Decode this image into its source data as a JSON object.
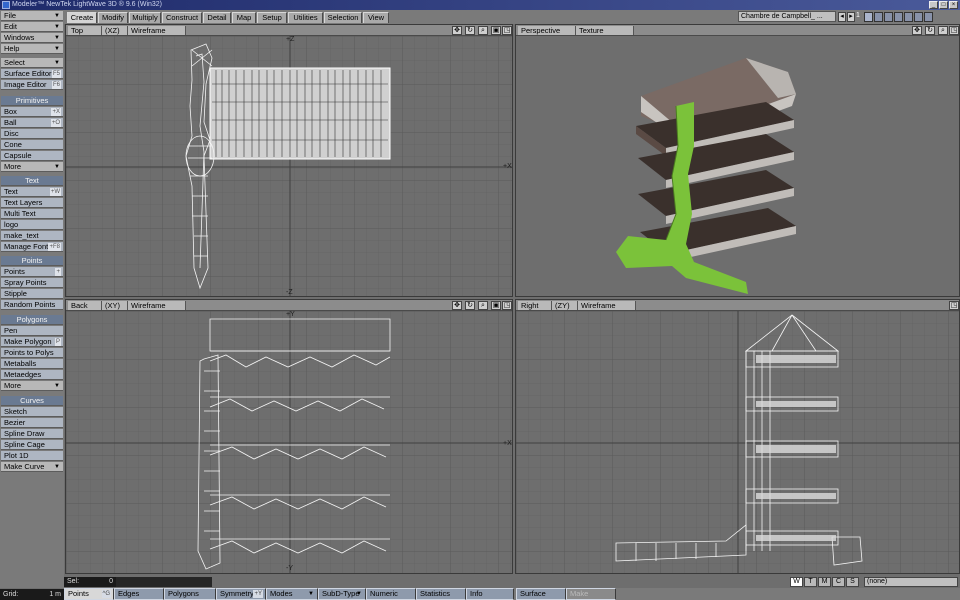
{
  "window": {
    "title": "Modeler™ NewTek LightWave 3D ® 9.6  (Win32)",
    "controls": [
      "_",
      "□",
      "×"
    ]
  },
  "left_toolbar": {
    "menus": [
      "File",
      "Edit",
      "Windows",
      "Help"
    ],
    "select": "Select",
    "surface_editor": "Surface Editor",
    "surface_editor_key": "F5",
    "image_editor": "Image Editor",
    "image_editor_key": "F6",
    "primitives_header": "Primitives",
    "primitives": [
      "Box",
      "Ball",
      "Disc",
      "Cone",
      "Capsule",
      "More"
    ],
    "primitives_keys": [
      "+X",
      "+O"
    ],
    "text_header": "Text",
    "text_items": [
      "Text",
      "Text Layers",
      "Multi Text",
      "logo",
      "make_text",
      "Manage Fonts"
    ],
    "text_keys": [
      "+W",
      "+F8"
    ],
    "points_header": "Points",
    "points_items": [
      "Points",
      "Spray Points",
      "Stipple",
      "Random Points"
    ],
    "points_key": "+",
    "polygons_header": "Polygons",
    "polygons_items": [
      "Pen",
      "Make Polygon",
      "Points to Polys",
      "Metaballs",
      "Metaedges",
      "More"
    ],
    "polygons_key": "P",
    "curves_header": "Curves",
    "curves_items": [
      "Sketch",
      "Bezier",
      "Spline Draw",
      "Spline Cage",
      "Plot 1D",
      "Make Curve"
    ],
    "grid_label": "Grid:",
    "grid_value": "1 m"
  },
  "tabs": [
    "Create",
    "Modify",
    "Multiply",
    "Construct",
    "Detail",
    "Map",
    "Setup",
    "Utilities",
    "Selection",
    "View"
  ],
  "active_tab": "Create",
  "scene_selector": "Chambre de Campbell_ ...",
  "layer_number": "1",
  "viewports": [
    {
      "view": "Top",
      "axes": "(XZ)",
      "mode": "Wireframe"
    },
    {
      "view": "Perspective",
      "axes": "",
      "mode": "Texture"
    },
    {
      "view": "Back",
      "axes": "(XY)",
      "mode": "Wireframe"
    },
    {
      "view": "Right",
      "axes": "(ZY)",
      "mode": "Wireframe"
    }
  ],
  "axis_labels": {
    "z_plus": "+Z",
    "z_minus": "-Z",
    "x_plus": "+X",
    "y_plus": "+Y",
    "y_minus": "-Y"
  },
  "viewport_icons": [
    "move-icon",
    "rotate-icon",
    "zoom-icon",
    "fit-icon",
    "maximize-icon"
  ],
  "status": {
    "sel_label": "Sel:",
    "sel_value": "0",
    "view_modes": [
      "W",
      "T",
      "M",
      "C",
      "S"
    ],
    "active_view_mode": "W",
    "surface": "(none)"
  },
  "bottom_modes": [
    "Points",
    "Edges",
    "Polygons",
    "Symmetry",
    "Modes",
    "SubD-Type",
    "Numeric",
    "Statistics",
    "Info",
    "Surface",
    "Make"
  ],
  "bottom_mode_keys": {
    "points": "^G",
    "symmetry": "+Y"
  },
  "active_mode": "Points",
  "colors": {
    "viewport_bg": "#6e6e6e",
    "grid_line": "#636363",
    "wireframe": "#ffffff",
    "mesh_green": "#7bc23a",
    "mesh_stone": "#5a4a44"
  }
}
